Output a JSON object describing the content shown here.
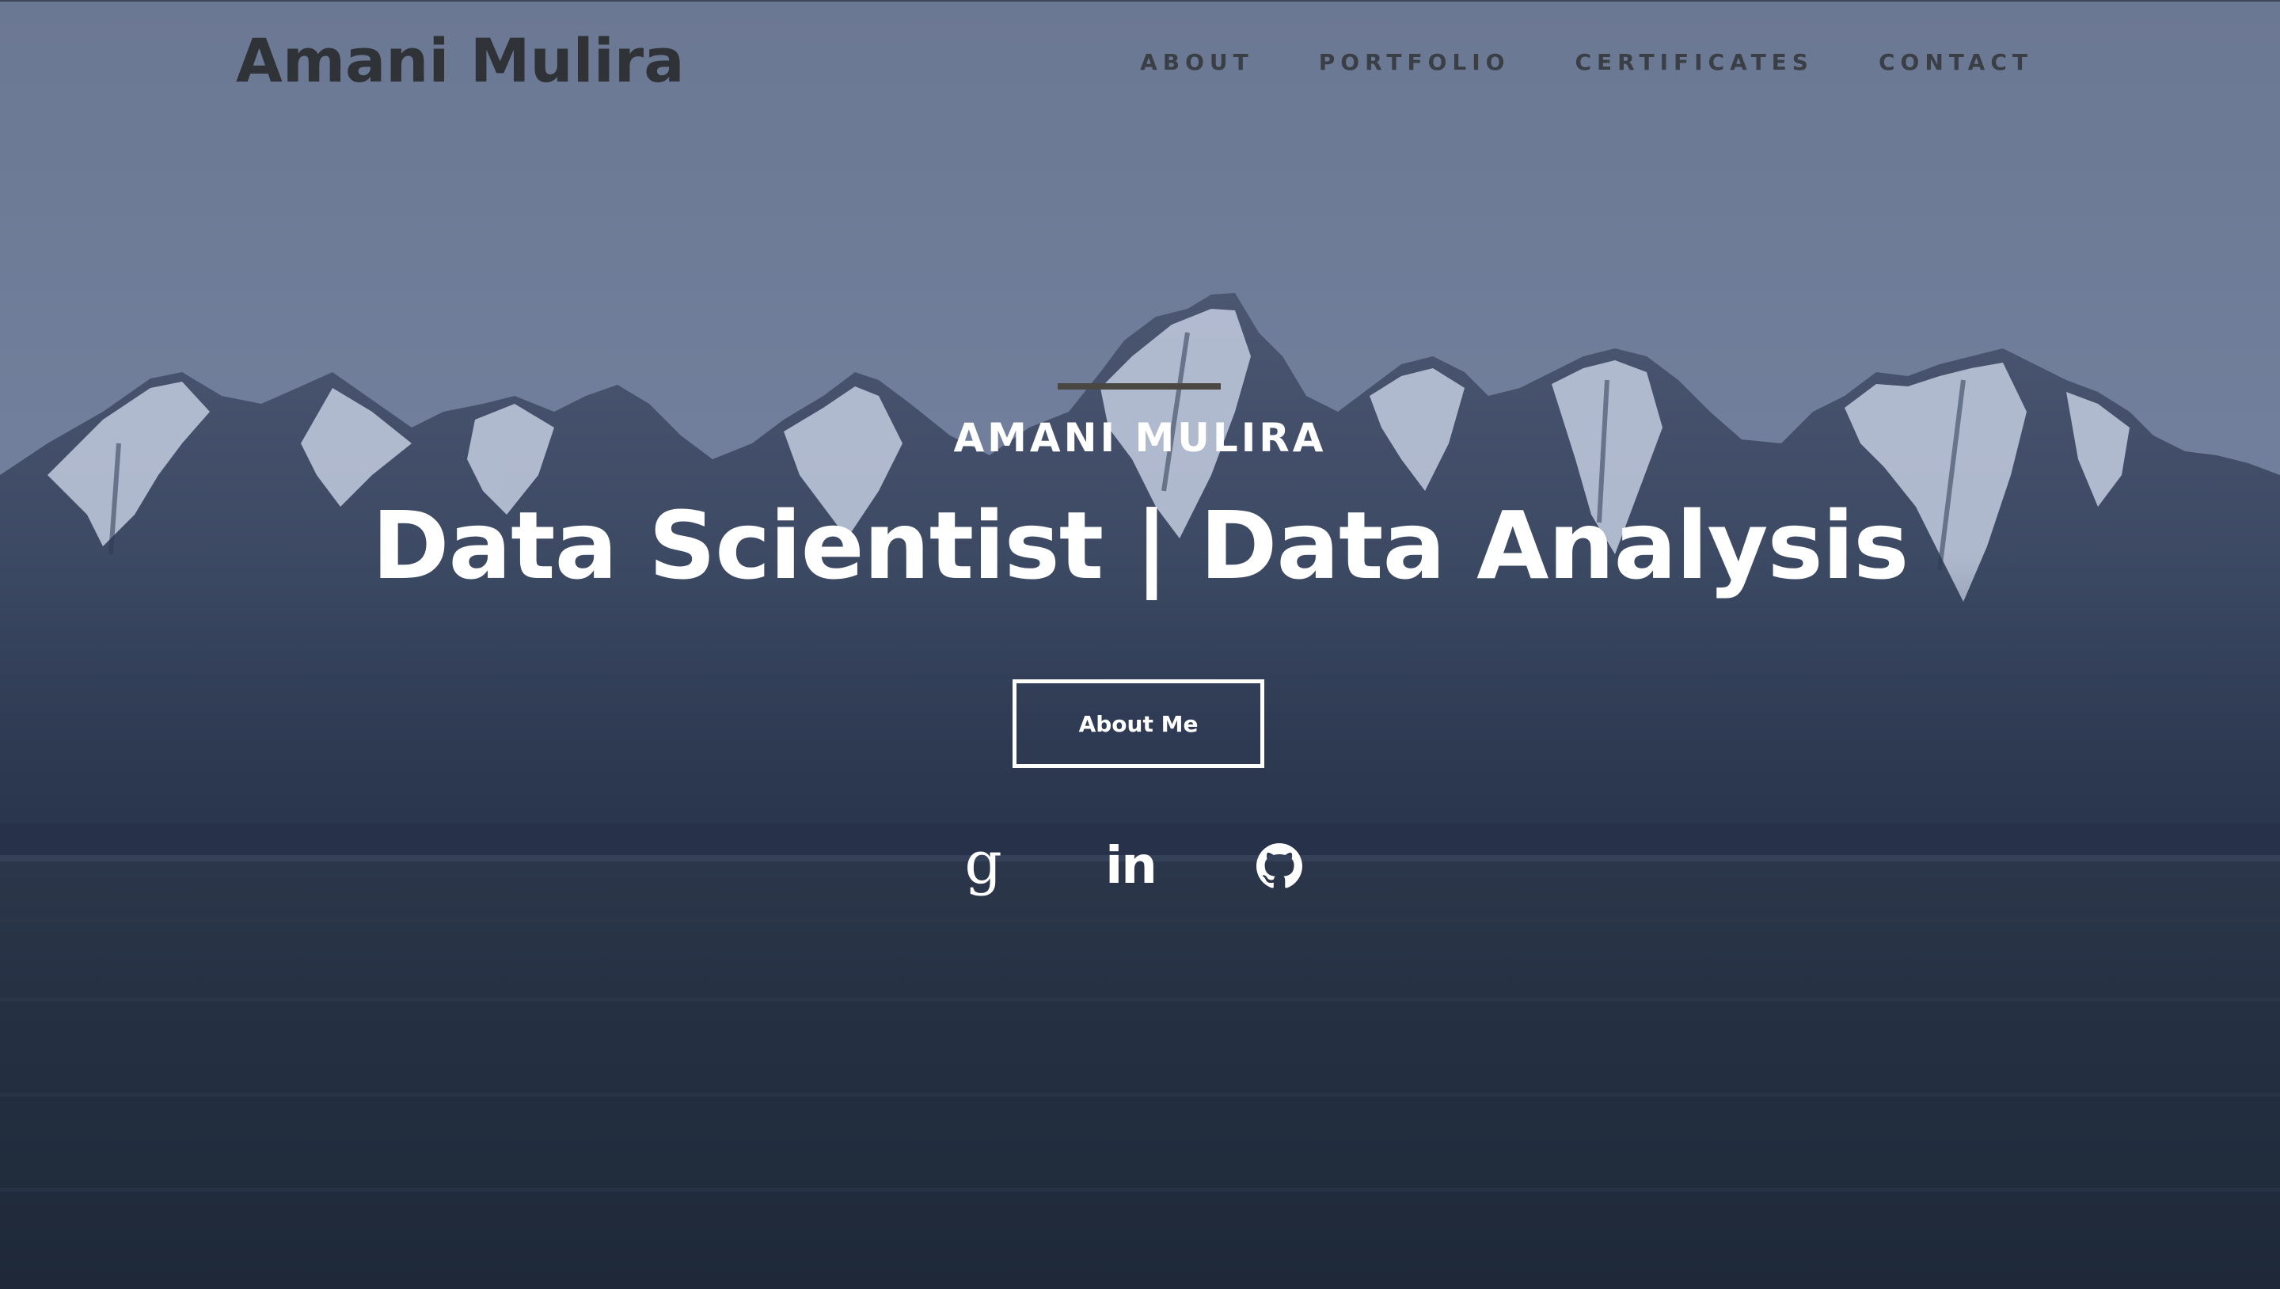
{
  "nav": {
    "brand": "Amani Mulira",
    "links": [
      "ABOUT",
      "PORTFOLIO",
      "CERTIFICATES",
      "CONTACT"
    ]
  },
  "hero": {
    "subtitle": "AMANI MULIRA",
    "title": "Data Scientist | Data Analysis",
    "button_label": "About Me"
  },
  "social": {
    "google_glyph": "g",
    "linkedin_glyph": "in",
    "icons": [
      "google-icon",
      "linkedin-icon",
      "github-icon"
    ]
  },
  "colors": {
    "sky": "#6e7c96",
    "mountain_dark": "#3a465c",
    "snow": "#c9d3e2",
    "field": "#253041",
    "brand_text": "#2f3237",
    "nav_text": "#3a3e45",
    "white": "#ffffff"
  }
}
